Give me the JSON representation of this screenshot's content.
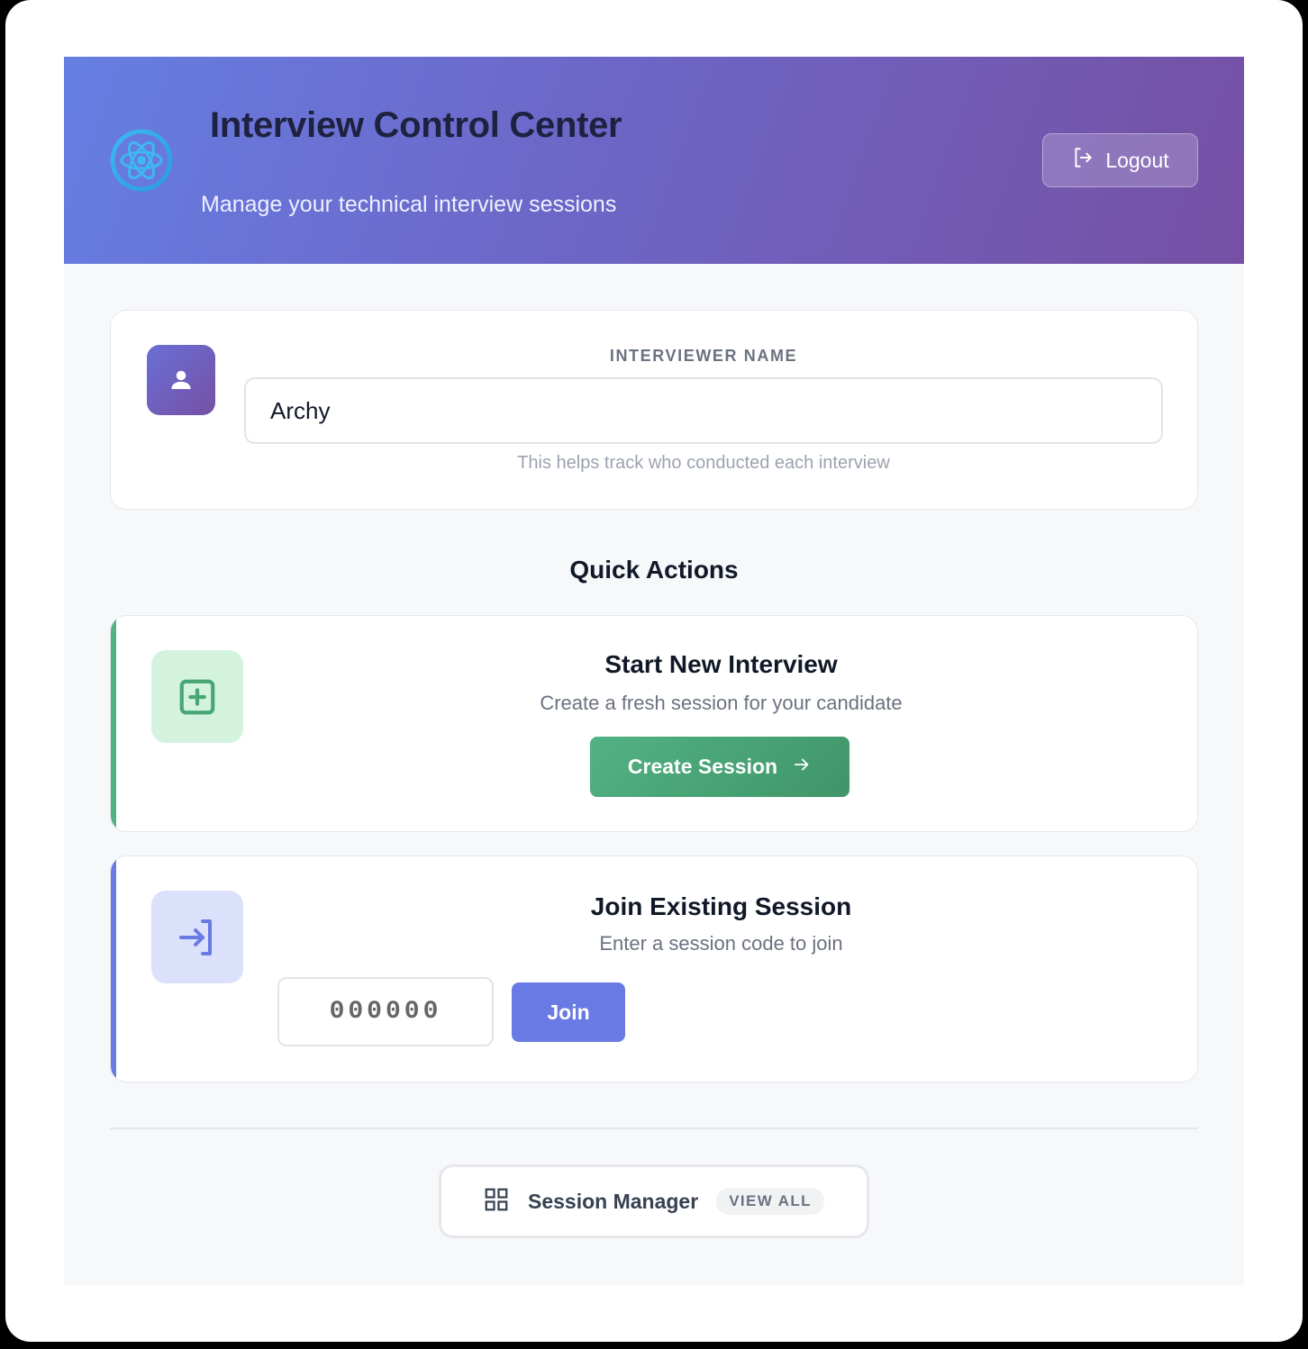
{
  "header": {
    "title": "Interview Control Center",
    "subtitle": "Manage your technical interview sessions",
    "logout_label": "Logout"
  },
  "interviewer": {
    "label": "INTERVIEWER NAME",
    "value": "Archy",
    "helper": "This helps track who conducted each interview"
  },
  "quick_actions": {
    "title": "Quick Actions",
    "create": {
      "title": "Start New Interview",
      "description": "Create a fresh session for your candidate",
      "button_label": "Create Session"
    },
    "join": {
      "title": "Join Existing Session",
      "description": "Enter a session code to join",
      "code_placeholder": "000000",
      "button_label": "Join"
    }
  },
  "session_manager": {
    "label": "Session Manager",
    "badge": "VIEW ALL"
  },
  "colors": {
    "header_gradient_start": "#667ee2",
    "header_gradient_end": "#7650a4",
    "create_accent": "#52b283",
    "join_accent": "#6a7ae4"
  },
  "icons": {
    "logo": "globe-atom-icon",
    "logout": "logout-icon",
    "avatar": "user-icon",
    "create": "plus-square-icon",
    "arrow": "arrow-right-icon",
    "join": "login-icon",
    "manager": "grid-icon"
  }
}
